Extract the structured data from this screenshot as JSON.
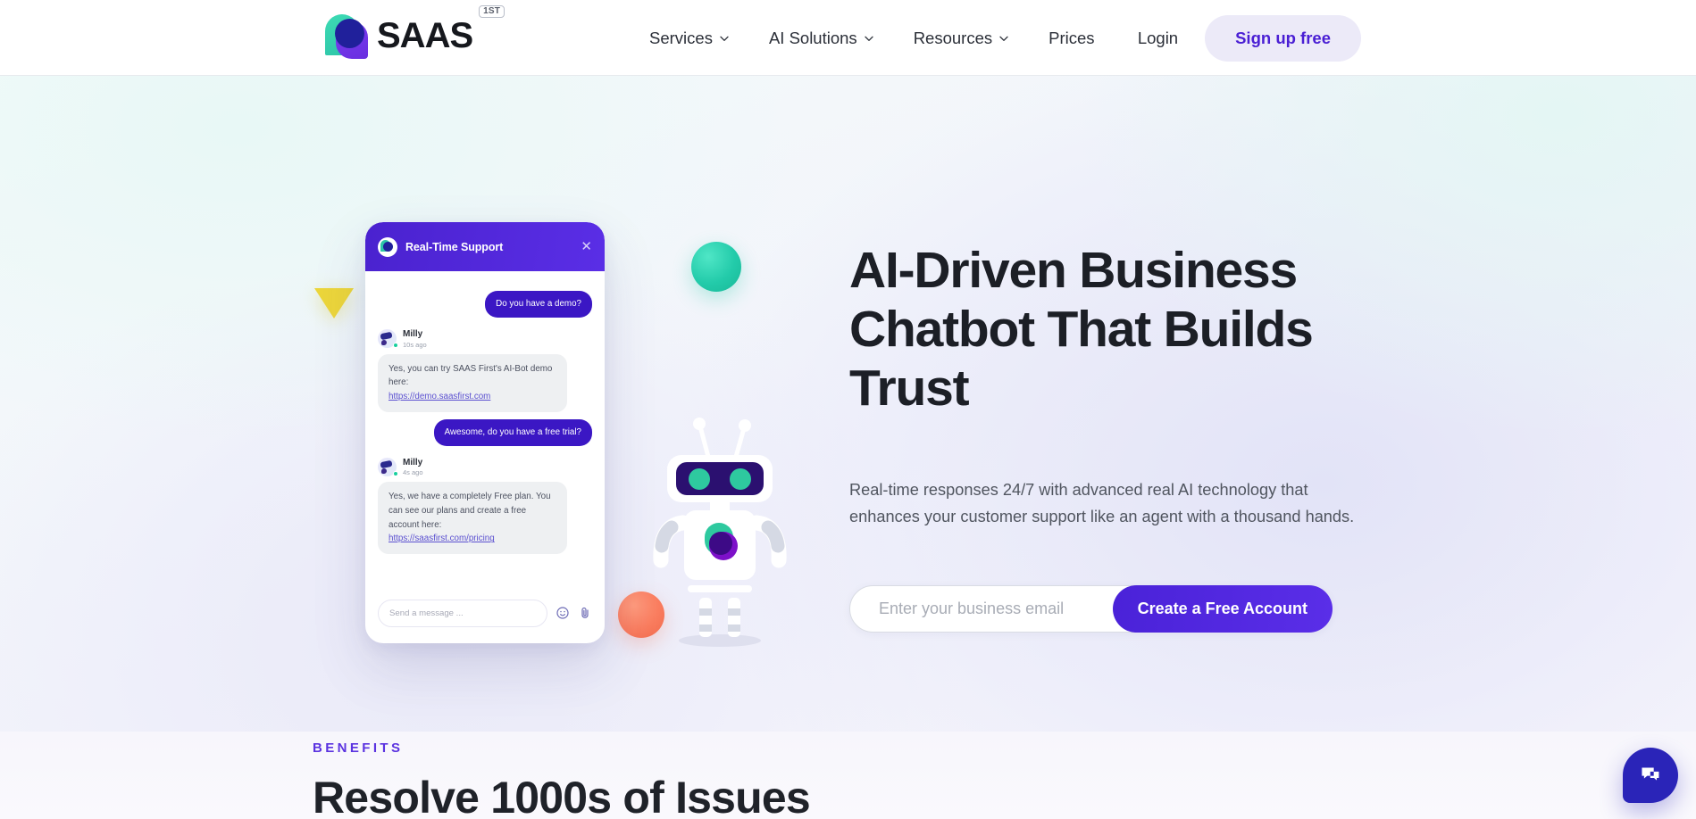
{
  "header": {
    "brand": {
      "name": "SAAS",
      "superscript": "1ST",
      "logo_icon": "saas-first-logo-icon"
    },
    "nav": [
      {
        "label": "Services",
        "has_dropdown": true
      },
      {
        "label": "AI Solutions",
        "has_dropdown": true
      },
      {
        "label": "Resources",
        "has_dropdown": true
      },
      {
        "label": "Prices",
        "has_dropdown": false
      }
    ],
    "login_label": "Login",
    "signup_label": "Sign up free",
    "signup_bg": "#eceaf8",
    "signup_color": "#4a1fd4"
  },
  "hero": {
    "title": "AI-Driven Business Chatbot That Builds Trust",
    "subtitle": "Real-time responses 24/7 with advanced real AI technology that enhances your customer support like an agent with a thousand hands.",
    "email_placeholder": "Enter your business email",
    "email_value": "",
    "cta_label": "Create a Free Account",
    "cta_color": "#4a22d8"
  },
  "chat_mockup": {
    "header_title": "Real-Time Support",
    "close_icon": "close-icon",
    "header_bg": "#4a22cf",
    "messages": [
      {
        "from": "user",
        "text": "Do you have a demo?"
      },
      {
        "from": "bot",
        "name": "Milly",
        "time": "10s ago",
        "text": "Yes, you can try SAAS First's AI-Bot demo here:",
        "link": "https://demo.saasfirst.com"
      },
      {
        "from": "user",
        "text": "Awesome, do you have a free trial?"
      },
      {
        "from": "bot",
        "name": "Milly",
        "time": "4s ago",
        "text": "Yes, we have a completely Free plan. You can see our plans and create a free account here:",
        "link": "https://saasfirst.com/pricing"
      }
    ],
    "input_placeholder": "Send a message ...",
    "emoji_icon": "emoji-smile-icon",
    "attach_icon": "paperclip-icon"
  },
  "decorations": {
    "teal_circle": "#23cbaa",
    "coral_circle": "#fa7d5f",
    "yellow_triangle": "#ecd63a",
    "robot_icon": "robot-mascot-icon"
  },
  "benefits": {
    "kicker": "BENEFITS",
    "kicker_color": "#5b33e0",
    "title": "Resolve 1000s of Issues"
  },
  "widget": {
    "fab_icon": "chat-bubble-icon",
    "fab_color": "#2a24b8"
  }
}
